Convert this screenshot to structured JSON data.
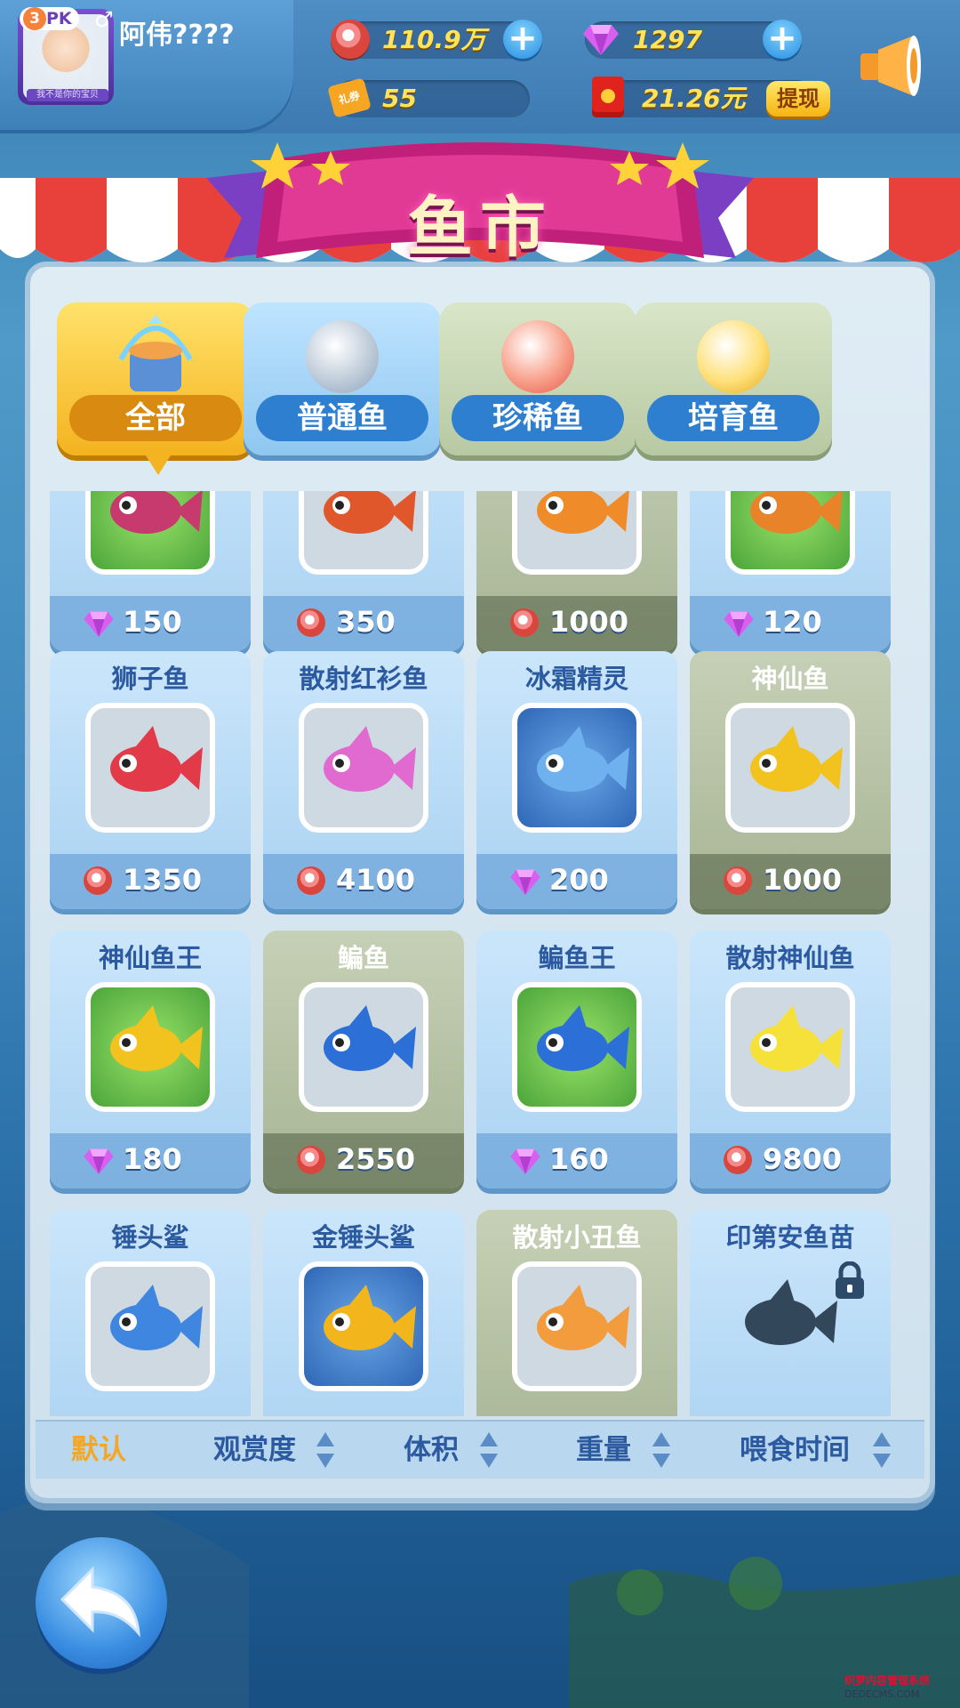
{
  "profile": {
    "level": "3",
    "pk_label": "PK",
    "gender_symbol": "♂",
    "nickname": "阿伟????",
    "avatar_caption": "我不是你的宝贝"
  },
  "resources": {
    "coins": "110.9万",
    "gems": "1297",
    "tickets": "55",
    "ticket_icon_label": "礼券",
    "cash": "21.26元",
    "withdraw_label": "提现"
  },
  "title": "鱼市",
  "tabs": [
    {
      "label": "全部",
      "selected": true
    },
    {
      "label": "普通鱼",
      "selected": false
    },
    {
      "label": "珍稀鱼",
      "selected": false
    },
    {
      "label": "培育鱼",
      "selected": false
    }
  ],
  "fish": [
    {
      "name": "",
      "price": "150",
      "currency": "gem",
      "frame": "green",
      "card": "blue"
    },
    {
      "name": "",
      "price": "350",
      "currency": "coin",
      "frame": "gray",
      "card": "blue"
    },
    {
      "name": "",
      "price": "1000",
      "currency": "coin",
      "frame": "gray",
      "card": "olive"
    },
    {
      "name": "",
      "price": "120",
      "currency": "gem",
      "frame": "green",
      "card": "blue"
    },
    {
      "name": "狮子鱼",
      "price": "1350",
      "currency": "coin",
      "frame": "gray",
      "card": "blue"
    },
    {
      "name": "散射红衫鱼",
      "price": "4100",
      "currency": "coin",
      "frame": "gray",
      "card": "blue"
    },
    {
      "name": "冰霜精灵",
      "price": "200",
      "currency": "gem",
      "frame": "blue",
      "card": "blue"
    },
    {
      "name": "神仙鱼",
      "price": "1000",
      "currency": "coin",
      "frame": "gray",
      "card": "olive"
    },
    {
      "name": "神仙鱼王",
      "price": "180",
      "currency": "gem",
      "frame": "green",
      "card": "blue"
    },
    {
      "name": "鳊鱼",
      "price": "2550",
      "currency": "coin",
      "frame": "gray",
      "card": "olive"
    },
    {
      "name": "鳊鱼王",
      "price": "160",
      "currency": "gem",
      "frame": "green",
      "card": "blue"
    },
    {
      "name": "散射神仙鱼",
      "price": "9800",
      "currency": "coin",
      "frame": "gray",
      "card": "blue"
    },
    {
      "name": "锤头鲨",
      "price": "",
      "currency": "",
      "frame": "gray",
      "card": "blue"
    },
    {
      "name": "金锤头鲨",
      "price": "",
      "currency": "",
      "frame": "blue",
      "card": "blue"
    },
    {
      "name": "散射小丑鱼",
      "price": "",
      "currency": "",
      "frame": "gray",
      "card": "olive"
    },
    {
      "name": "印第安鱼苗",
      "price": "",
      "currency": "",
      "frame": "none",
      "card": "blue",
      "locked": true
    }
  ],
  "sort": {
    "default": "默认",
    "appreciation": "观赏度",
    "volume": "体积",
    "weight": "重量",
    "feeding_time": "喂食时间"
  },
  "watermark": {
    "line1": "织梦内容管理系统",
    "line2": "DEDECMS.COM"
  },
  "colors": {
    "gold": "#f4b320",
    "gem": "#c84be0",
    "coin": "#d9463d",
    "blue_label": "#2c5aa0"
  }
}
